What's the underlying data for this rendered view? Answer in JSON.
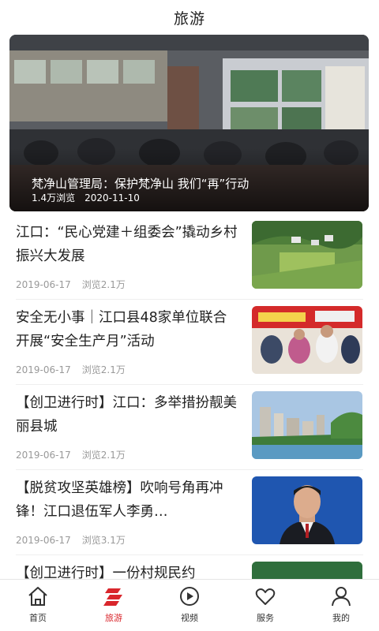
{
  "header": {
    "title": "旅游"
  },
  "hero": {
    "title": "梵净山管理局：保护梵净山 我们“再”行动",
    "views": "1.4万浏览",
    "date": "2020-11-10"
  },
  "news": [
    {
      "title": "江口：“民心党建＋组委会”撬动乡村振兴大发展",
      "date": "2019-06-17",
      "views": "浏览2.1万"
    },
    {
      "title": "安全无小事｜江口县48家单位联合开展“安全生产月”活动",
      "date": "2019-06-17",
      "views": "浏览2.1万"
    },
    {
      "title": "【创卫进行时】江口：多举措扮靓美丽县城",
      "date": "2019-06-17",
      "views": "浏览2.1万"
    },
    {
      "title": "【脱贫攻坚英雄榜】吹响号角再冲锋！江口退伍军人李勇…",
      "date": "2019-06-17",
      "views": "浏览3.1万"
    },
    {
      "title": "【创卫进行时】一份村规民约",
      "date": "",
      "views": ""
    }
  ],
  "tabs": [
    {
      "label": "首页",
      "icon": "home-icon"
    },
    {
      "label": "旅游",
      "icon": "travel-icon",
      "active": true
    },
    {
      "label": "视频",
      "icon": "play-icon"
    },
    {
      "label": "服务",
      "icon": "heart-icon"
    },
    {
      "label": "我的",
      "icon": "user-icon"
    }
  ],
  "colors": {
    "accent": "#d9262c",
    "text": "#222222",
    "meta": "#999999"
  }
}
